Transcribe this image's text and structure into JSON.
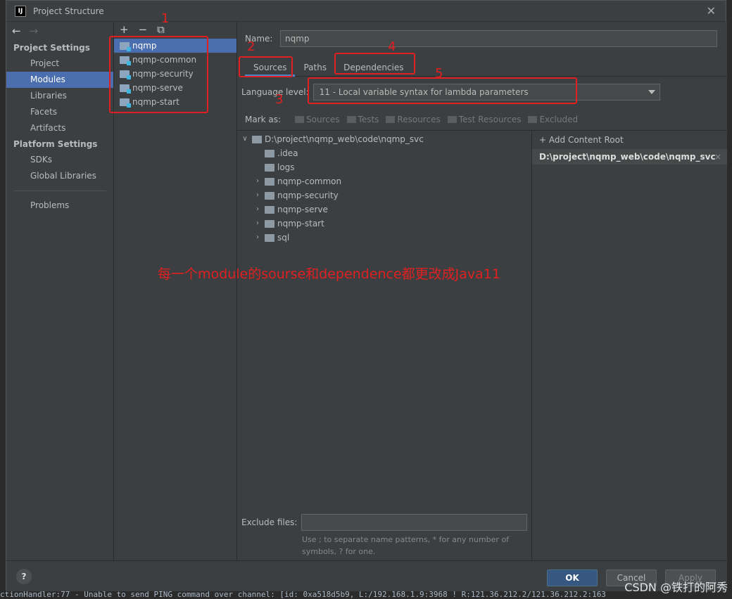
{
  "window": {
    "title": "Project Structure",
    "app_icon": "IJ"
  },
  "nav": {
    "project_settings": "Project Settings",
    "project_items": [
      "Project",
      "Modules",
      "Libraries",
      "Facets",
      "Artifacts"
    ],
    "platform_settings": "Platform Settings",
    "platform_items": [
      "SDKs",
      "Global Libraries"
    ],
    "problems": "Problems"
  },
  "modules": [
    "nqmp",
    "nqmp-common",
    "nqmp-security",
    "nqmp-serve",
    "nqmp-start"
  ],
  "main": {
    "name_label": "Name:",
    "name_value": "nqmp",
    "tabs": [
      "Sources",
      "Paths",
      "Dependencies"
    ],
    "language_level_label": "Language level:",
    "language_level_value": "11 - Local variable syntax for lambda parameters",
    "mark_as_label": "Mark as:",
    "mark_as": [
      "Sources",
      "Tests",
      "Resources",
      "Test Resources",
      "Excluded"
    ],
    "tree_root": "D:\\project\\nqmp_web\\code\\nqmp_svc",
    "tree_children": [
      {
        "label": ".idea",
        "expandable": false
      },
      {
        "label": "logs",
        "expandable": false
      },
      {
        "label": "nqmp-common",
        "expandable": true
      },
      {
        "label": "nqmp-security",
        "expandable": true
      },
      {
        "label": "nqmp-serve",
        "expandable": true
      },
      {
        "label": "nqmp-start",
        "expandable": true
      },
      {
        "label": "sql",
        "expandable": true
      }
    ],
    "add_content_root": "Add Content Root",
    "content_root": "D:\\project\\nqmp_web\\code\\nqmp_svc",
    "exclude_label": "Exclude files:",
    "exclude_hint": "Use ; to separate name patterns, * for any number of symbols, ? for one."
  },
  "footer": {
    "help": "?",
    "ok": "OK",
    "cancel": "Cancel",
    "apply": "Apply"
  },
  "annotations": {
    "n1": "1",
    "n2": "2",
    "n3": "3",
    "n4": "4",
    "n5": "5",
    "note": "每一个module的sourse和dependence都更改成Java11"
  },
  "background": {
    "bottom_log": "ctionHandler:77 - Unable to send PING command over channel: [id: 0xa518d5b9, L:/192.168.1.9:3968 ! R:121.36.212.2/121.36.212.2:163"
  },
  "watermark": "CSDN @铁打的阿秀",
  "colors": {
    "selection": "#4b6eaf",
    "annotation": "#e02020",
    "ok_button": "#365880"
  }
}
